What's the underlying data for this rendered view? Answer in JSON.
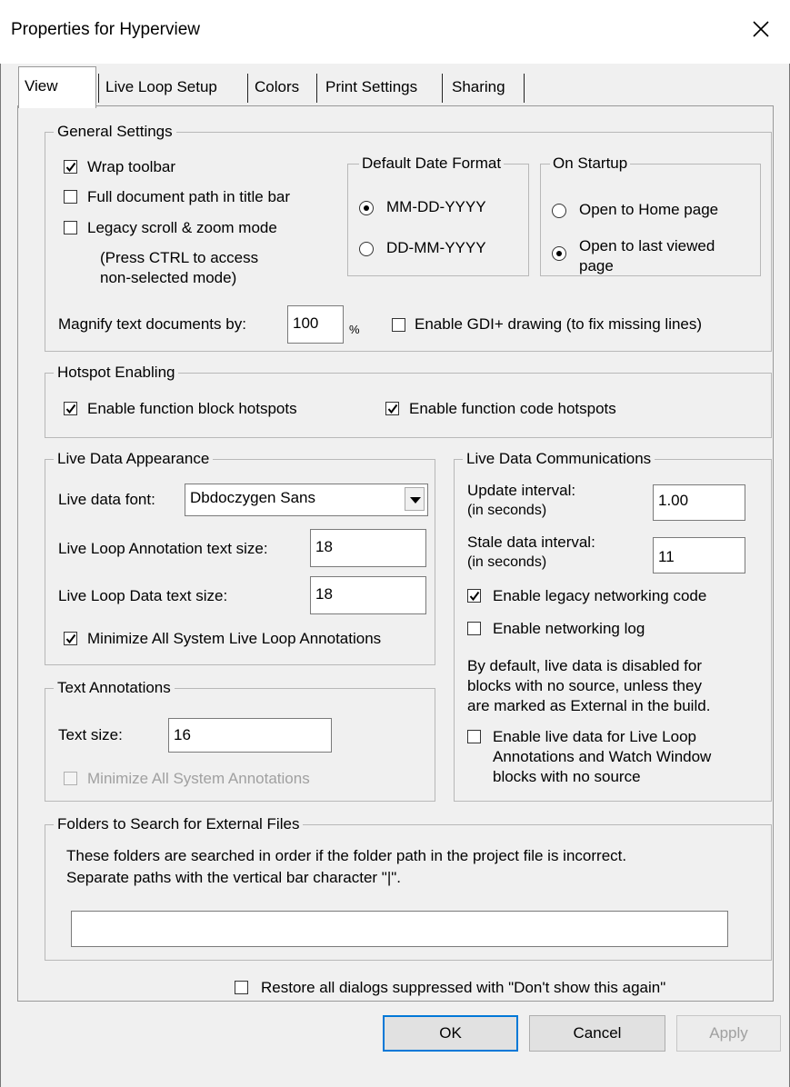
{
  "window": {
    "title": "Properties for Hyperview"
  },
  "tabs": [
    {
      "label": "View",
      "active": true
    },
    {
      "label": "Live Loop Setup",
      "active": false
    },
    {
      "label": "Colors",
      "active": false
    },
    {
      "label": "Print Settings",
      "active": false
    },
    {
      "label": "Sharing",
      "active": false
    }
  ],
  "general": {
    "title": "General Settings",
    "wrap_toolbar": {
      "label": "Wrap toolbar",
      "checked": true
    },
    "full_path": {
      "label": "Full document path in title bar",
      "checked": false
    },
    "legacy_scroll": {
      "label": "Legacy scroll & zoom mode",
      "checked": false
    },
    "legacy_note_1": "(Press CTRL to access",
    "legacy_note_2": "non-selected mode)",
    "date_format": {
      "title": "Default Date Format",
      "options": [
        {
          "label": "MM-DD-YYYY",
          "selected": true
        },
        {
          "label": "DD-MM-YYYY",
          "selected": false
        }
      ]
    },
    "on_startup": {
      "title": "On Startup",
      "home_label": "Open to Home page",
      "home_selected": false,
      "last_label_1": "Open to last viewed",
      "last_label_2": "page",
      "last_selected": true
    },
    "magnify_label": "Magnify text documents by:",
    "magnify_value": "100",
    "magnify_unit": "%",
    "gdi": {
      "label": "Enable GDI+ drawing (to fix missing lines)",
      "checked": false
    }
  },
  "hotspot": {
    "title": "Hotspot Enabling",
    "block": {
      "label": "Enable function block hotspots",
      "checked": true
    },
    "code": {
      "label": "Enable function code hotspots",
      "checked": true
    }
  },
  "live_appearance": {
    "title": "Live Data Appearance",
    "font_label": "Live data font:",
    "font_value": "Dbdoczygen Sans",
    "annotation_size_label": "Live Loop Annotation text size:",
    "annotation_size_value": "18",
    "data_size_label": "Live Loop Data text size:",
    "data_size_value": "18",
    "minimize": {
      "label": "Minimize All System Live Loop Annotations",
      "checked": true
    }
  },
  "live_comm": {
    "title": "Live Data Communications",
    "update_label_1": "Update interval:",
    "update_label_2": "(in seconds)",
    "update_value": "1.00",
    "stale_label_1": "Stale data interval:",
    "stale_label_2": "(in seconds)",
    "stale_value": "11",
    "legacy_net": {
      "label": "Enable legacy networking code",
      "checked": true
    },
    "net_log": {
      "label": "Enable networking log",
      "checked": false
    },
    "info_1": "By default, live data is disabled for",
    "info_2": "blocks with no source, unless they",
    "info_3": "are marked as External in the build.",
    "enable_live_1": "Enable live data for Live Loop",
    "enable_live_2": "Annotations and Watch Window",
    "enable_live_3": "blocks with no source",
    "enable_live_checked": false
  },
  "text_annotations": {
    "title": "Text Annotations",
    "size_label": "Text size:",
    "size_value": "16",
    "minimize": {
      "label": "Minimize All System Annotations",
      "checked": false,
      "disabled": true
    }
  },
  "folders": {
    "title": "Folders to Search for External Files",
    "desc_1": "These folders are searched in order if the folder path in the project file is incorrect.",
    "desc_2": "Separate paths with the vertical bar character \"|\".",
    "path_value": ""
  },
  "restore": {
    "label": "Restore all dialogs suppressed with \"Don't show this again\"",
    "checked": false
  },
  "buttons": {
    "ok": "OK",
    "cancel": "Cancel",
    "apply": "Apply"
  }
}
